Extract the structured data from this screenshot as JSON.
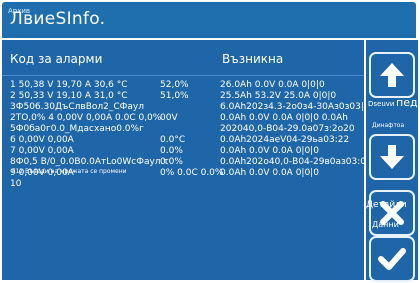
{
  "title": {
    "main": "ЛвиеSInfo.",
    "small": "Архив"
  },
  "table": {
    "header_code": "Код за аларми",
    "header_occurrence": "Възникна",
    "rows": [
      {
        "c1": "1 50,38 V 19,70 A 30,6 °C",
        "c2": "52,0%",
        "c3": "26.0Ah 0.0V 0.0A 0|0|0"
      },
      {
        "c1": "2 50,33 V 19,10 A 31,0 °C",
        "c2": "51,0%",
        "c3": "25.5Ah 53.2V 25.0A 0|0|0"
      },
      {
        "c1": "3Ф506.30ДъСлвВол2_СФаул",
        "c2": "",
        "c3": "6.0Ah202з4.3-2о0з4-З0Аз0з03|03|0"
      },
      {
        "c1": "2ТО,0% 4 0,00V 0,00A 0.0C 0,0%",
        "c2": "00V",
        "c3": "0.0Ah 0.0V 0.0A 0|0|0 0.0Ah"
      },
      {
        "c1": "5Ф0ба0г0.0_Мдасхано0.0%г",
        "c2": "",
        "c3": "202040,0-В04-29.0а07з:2о20"
      },
      {
        "c1": "6  0,00V 0,00A",
        "c2": "0.0°C",
        "c3": "0.0Ah2024аеV04-29ьа03:22"
      },
      {
        "c1": "7  0,00V 0,00A",
        "c2": "0.0%",
        "c3": "0.0Ah 0.0V 0.0A 0|0|0"
      },
      {
        "c1": "8Ф0,5 В/0_0.0В0.0АтLo0WсФаул.т",
        "c2": "0.0%",
        "c3": "0.0Ah202о40,0-В04-29в0аз03:01о10"
      },
      {
        "c1": "9  0,00V 0,00A",
        "c2": "0% 0.0C 0.0%",
        "c3": "0.0Ah 0.0V 0.0A 0|0|0"
      },
      {
        "c1": "10",
        "c2": "",
        "c3": ""
      }
    ],
    "overlay_small": "F12 Въведи на мрежата се промени"
  },
  "side": {
    "label_top": "Dseuvи",
    "label_top_big": "пед",
    "label_mid": "Динафтоа",
    "label_bottom": "Детайли",
    "label_bottom2": "Данни"
  },
  "colors": {
    "titlebar": "#1f6fae",
    "panel": "#1e66a8",
    "button_border": "#e8f2ff",
    "text": "#ffffff"
  },
  "icons": [
    "arrow-up-icon",
    "arrow-down-icon",
    "close-icon",
    "check-icon"
  ]
}
